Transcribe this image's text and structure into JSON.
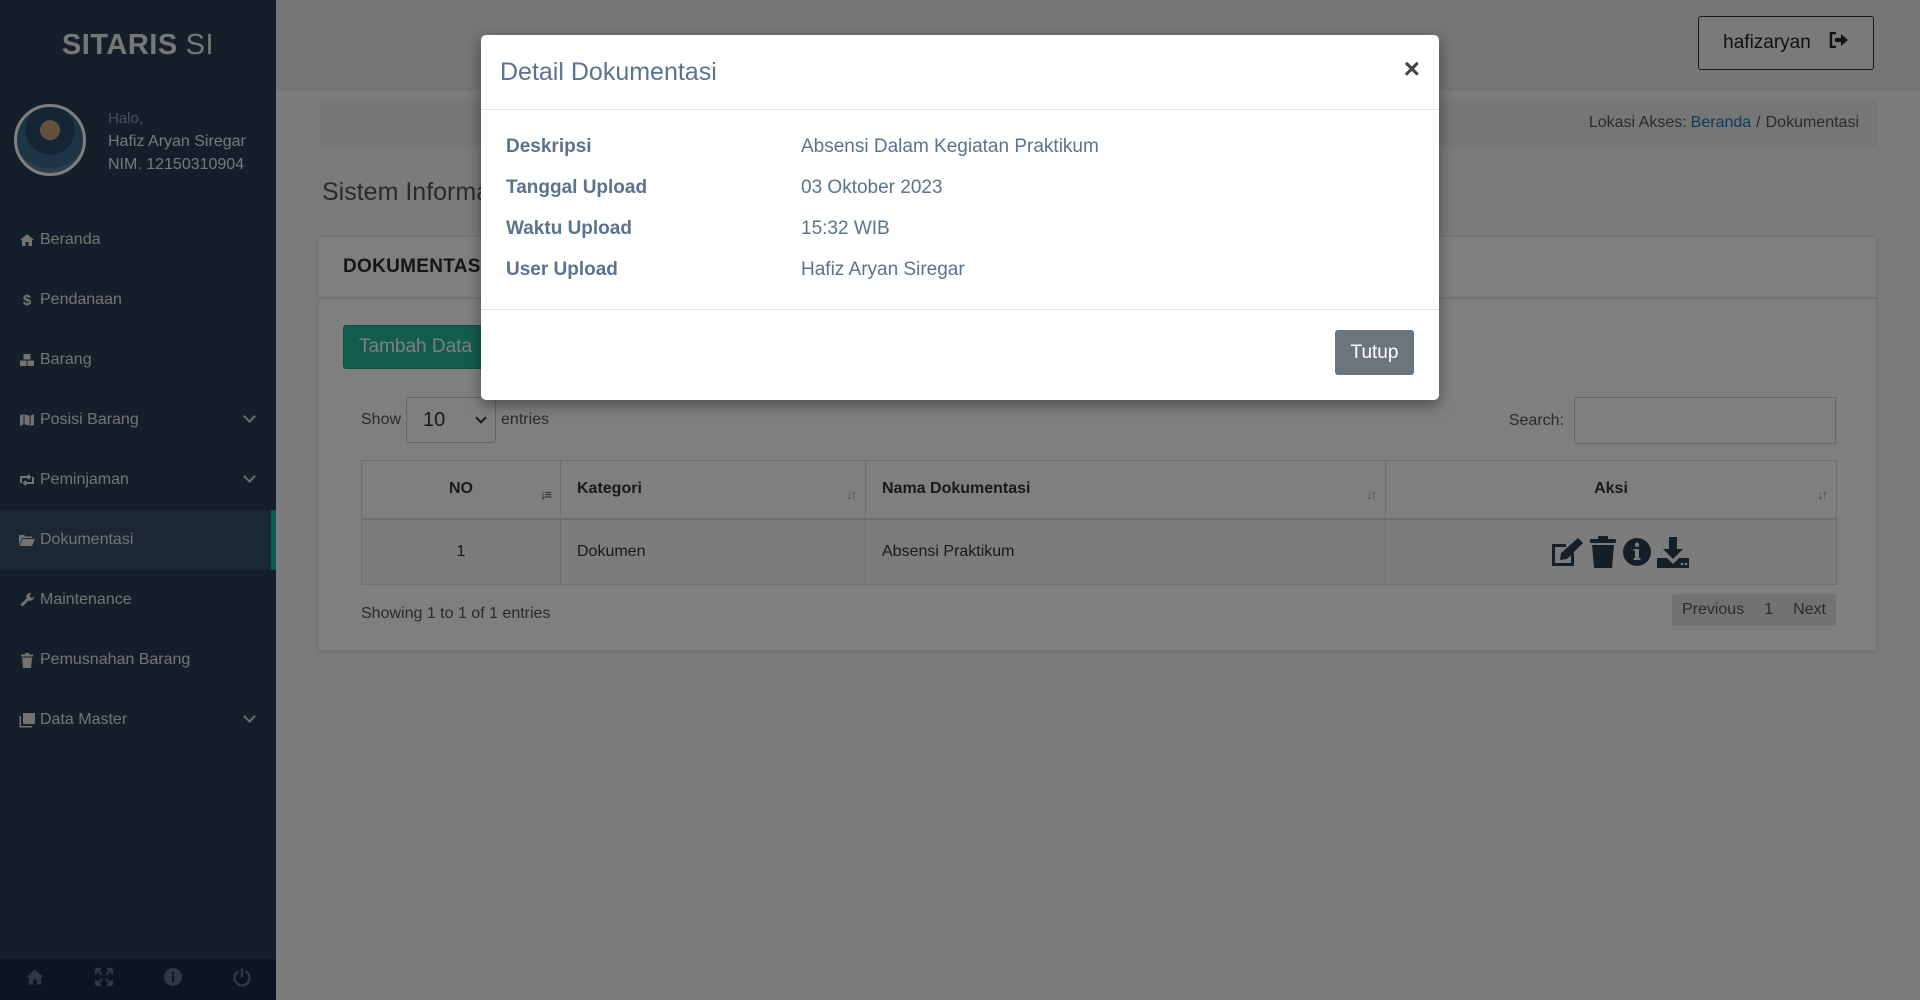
{
  "sidebar": {
    "brand_bold": "SITARIS",
    "brand_light": "SI",
    "greeting": "Halo,",
    "user_name": "Hafiz Aryan Siregar",
    "user_nim": "NIM. 12150310904",
    "items": [
      {
        "label": "Beranda",
        "icon": "home-icon",
        "has_chevron": false
      },
      {
        "label": "Pendanaan",
        "icon": "dollar-icon",
        "has_chevron": false
      },
      {
        "label": "Barang",
        "icon": "cubes-icon",
        "has_chevron": false
      },
      {
        "label": "Posisi Barang",
        "icon": "map-icon",
        "has_chevron": true
      },
      {
        "label": "Peminjaman",
        "icon": "retweet-icon",
        "has_chevron": true
      },
      {
        "label": "Dokumentasi",
        "icon": "folder-open-icon",
        "has_chevron": false,
        "active": true
      },
      {
        "label": "Maintenance",
        "icon": "wrench-icon",
        "has_chevron": false
      },
      {
        "label": "Pemusnahan Barang",
        "icon": "trash-icon",
        "has_chevron": false
      },
      {
        "label": "Data Master",
        "icon": "clone-icon",
        "has_chevron": true
      }
    ],
    "footer_icons": [
      "home-icon",
      "fullscreen-icon",
      "info-icon",
      "power-icon"
    ]
  },
  "topnav": {
    "username": "hafizaryan"
  },
  "breadcrumb": {
    "prefix": "Lokasi Akses:",
    "home": "Beranda",
    "separator": "/",
    "current": "Dokumentasi"
  },
  "page": {
    "title": "Sistem Informa"
  },
  "panel": {
    "title": "DOKUMENTASI",
    "add_button": "Tambah Data",
    "show_label": "Show",
    "entries_value": "10",
    "entries_label": "entries",
    "search_label": "Search:",
    "search_value": "",
    "columns": [
      "NO",
      "Kategori",
      "Nama Dokumentasi",
      "Aksi"
    ],
    "rows": [
      {
        "no": "1",
        "kategori": "Dokumen",
        "nama": "Absensi Praktikum",
        "actions": [
          "edit-icon",
          "trash-icon",
          "info-icon",
          "download-icon"
        ]
      }
    ],
    "info": "Showing 1 to 1 of 1 entries",
    "pager": {
      "previous": "Previous",
      "page": "1",
      "next": "Next"
    }
  },
  "modal": {
    "title": "Detail Dokumentasi",
    "close_symbol": "×",
    "fields": [
      {
        "label": "Deskripsi",
        "value": "Absensi Dalam Kegiatan Praktikum"
      },
      {
        "label": "Tanggal Upload",
        "value": "03 Oktober 2023"
      },
      {
        "label": "Waktu Upload",
        "value": "15:32 WIB"
      },
      {
        "label": "User Upload",
        "value": "Hafiz Aryan Siregar"
      }
    ],
    "close_button": "Tutup"
  },
  "colors": {
    "sidebar_bg": "#2a3f54",
    "accent": "#1abb9c",
    "add_button": "#26b99a",
    "action_icon": "#2a3f54",
    "modal_text": "#5a738e",
    "close_button": "#6c757d"
  }
}
